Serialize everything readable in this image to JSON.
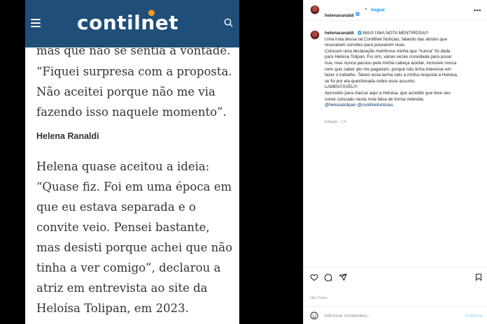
{
  "article": {
    "site_logo": "contilnet",
    "paragraph_top": "mas que não se sentia à vontade.",
    "quote_lines": [
      "“Fiquei surpresa com a proposta.",
      "Não aceitei porque não me via",
      "fazendo isso naquele momento”."
    ],
    "subheading": "Helena Ranaldi",
    "body_lines": [
      "Helena quase aceitou a ideia:",
      "“Quase fiz. Foi em uma época em",
      "que eu estava separada e o",
      "convite veio. Pensei bastante,",
      "mas desisti porque achei que não",
      "tinha a ver comigo”, declarou a",
      "atriz em entrevista ao site da",
      "Heloísa Tolipan, em 2023."
    ]
  },
  "post": {
    "username": "helenaranaldi",
    "separator": "•",
    "follow_label": "Seguir",
    "more_icon": "more-horizontal-icon",
    "caption_first": "MAIS UMA NOTA MENTIROSA!!!",
    "caption_lines": [
      "Uma nota dessa tal ContilNet Notícias, falando das atrizes que",
      "recusaram convites para pousarem nuas.",
      "Colocam uma declaração mentirosa minha que \"nunca\" foi dada",
      "para Heloisa Tolipan. Fui sim, várias vezes convidada para posar",
      "nua, mas nunca passou pela minha cabeça aceitar, inclusive nunca",
      "nem quis saber qto me pagariam, porque não tinha interesse em",
      "fazer o trabalho. Talvez essa tenha sido a minha resposta à Heloisa,",
      "se foi por ela questionada sobre esse assunto.",
      "LAMENTÁVEL!!!",
      "Aproveito para marcar aqui a Heloisa, que acredito que teve seu",
      "nome colocado nesta nota falsa de forma indevida."
    ],
    "mentions": "@heloisatolipan @contilnetnoticias",
    "edited_time": "Editado · 1 h",
    "time_ago": "Há 1 hora",
    "comment_placeholder": "Adicionar comentário...",
    "publish_label": "Publicar"
  },
  "colors": {
    "site_header": "#1f4e79",
    "link_blue": "#0095f6",
    "verified": "#3897f0"
  }
}
